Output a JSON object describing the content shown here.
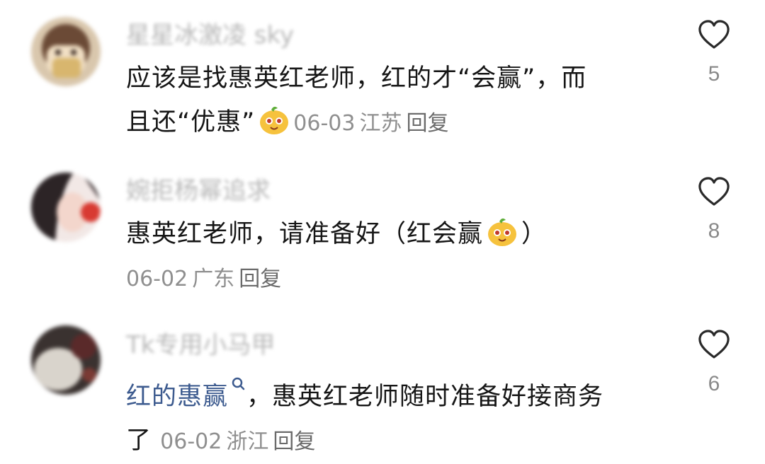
{
  "comments": [
    {
      "username": "星星冰激凌 sky",
      "text_line1": "应该是找惠英红老师，红的才“会赢”，而",
      "text_line2": "且还“优惠”",
      "date": "06-03",
      "location": "江苏",
      "reply_label": "回复",
      "likes": "5"
    },
    {
      "username": "婉拒杨幂追求",
      "text_part1": "惠英红老师，请准备好（红会赢",
      "text_part2": "）",
      "date": "06-02",
      "location": "广东",
      "reply_label": "回复",
      "likes": "8"
    },
    {
      "username": "Tk专用小马甲",
      "link_text": "红的惠赢",
      "text_part1": "，惠英红老师随时准备好接商务",
      "text_part2": "了",
      "date": "06-02",
      "location": "浙江",
      "reply_label": "回复",
      "likes": "6"
    }
  ],
  "icons": {
    "like": "heart-outline-icon",
    "emoji": "orange-face-emoji",
    "search": "search-icon"
  },
  "colors": {
    "like_stroke": "#2a2a2a",
    "link": "#3d5b8f",
    "meta": "#8f8f8f"
  }
}
